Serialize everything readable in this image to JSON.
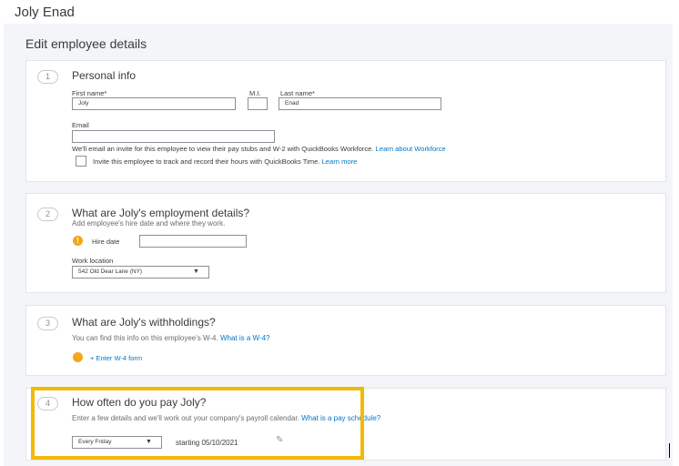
{
  "header": {
    "title": "Joly Enad"
  },
  "panel": {
    "title": "Edit employee details"
  },
  "personal": {
    "step": "1",
    "title": "Personal info",
    "first_name_label": "First name*",
    "first_name_value": "Joly",
    "mi_label": "M.I.",
    "mi_value": "",
    "last_name_label": "Last name*",
    "last_name_value": "Enad",
    "email_label": "Email",
    "email_value": "",
    "invite_text": "We'll email an invite for this employee to view their pay stubs and W-2 with QuickBooks Workforce.",
    "invite_link": "Learn about Workforce",
    "track_text": "Invite this employee to track and record their hours with QuickBooks Time.",
    "track_link": "Learn more"
  },
  "employment": {
    "step": "2",
    "title": "What are Joly's employment details?",
    "subtitle": "Add employee's hire date and where they work.",
    "hire_date_label": "Hire date",
    "hire_date_value": "",
    "work_location_label": "Work location",
    "work_location_value": "542 Old Dear Lane (NY)"
  },
  "withholdings": {
    "step": "3",
    "title": "What are Joly's withholdings?",
    "subtitle": "You can find this info on this employee's W-4.",
    "subtitle_link": "What is a W-4?",
    "w4_link": "+ Enter W-4 form"
  },
  "pay": {
    "step": "4",
    "title": "How often do you pay Joly?",
    "subtitle": "Enter a few details and we'll work out your company's payroll calendar.",
    "subtitle_link": "What is a pay schedule?",
    "frequency_value": "Every Friday",
    "starting_text": "starting 05/10/2021"
  },
  "colors": {
    "link": "#0077c5",
    "warning": "#f4a61d",
    "highlight": "#f2b905"
  },
  "icons": {
    "warning": "warning-icon",
    "dropdown": "chevron-down-icon",
    "edit": "pencil-icon"
  }
}
